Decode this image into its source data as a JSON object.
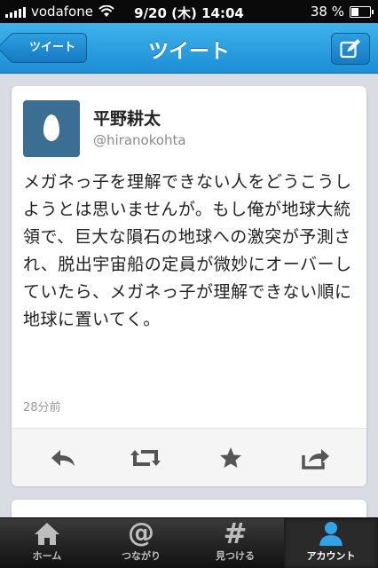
{
  "status_bar": {
    "carrier": "vodafone",
    "time": "9/20 (木) 14:04",
    "battery_text": "38 %",
    "battery_level": 0.38
  },
  "nav": {
    "back_label": "ツイート",
    "title": "ツイート",
    "compose_icon": "compose-icon"
  },
  "tweet": {
    "name": "平野耕太",
    "handle": "@hiranokohta",
    "text": "メガネっ子を理解できない人をどうこうしようとは思いませんが。もし俺が地球大統領で、巨大な隕石の地球への激突が予測され、脱出宇宙船の定員が微妙にオーバーしていたら、メガネっ子が理解できない順に地球に置いてく。",
    "time": "28分前",
    "actions": [
      "reply-icon",
      "retweet-icon",
      "favorite-icon",
      "share-icon"
    ]
  },
  "tabs": [
    {
      "label": "ホーム",
      "icon": "home-icon",
      "active": false
    },
    {
      "label": "つながり",
      "icon": "at-icon",
      "active": false
    },
    {
      "label": "見つける",
      "icon": "hashtag-icon",
      "active": false
    },
    {
      "label": "アカウント",
      "icon": "person-icon",
      "active": true
    }
  ],
  "colors": {
    "nav_blue": "#1c8ed6",
    "avatar_bg": "#3a6f93"
  }
}
